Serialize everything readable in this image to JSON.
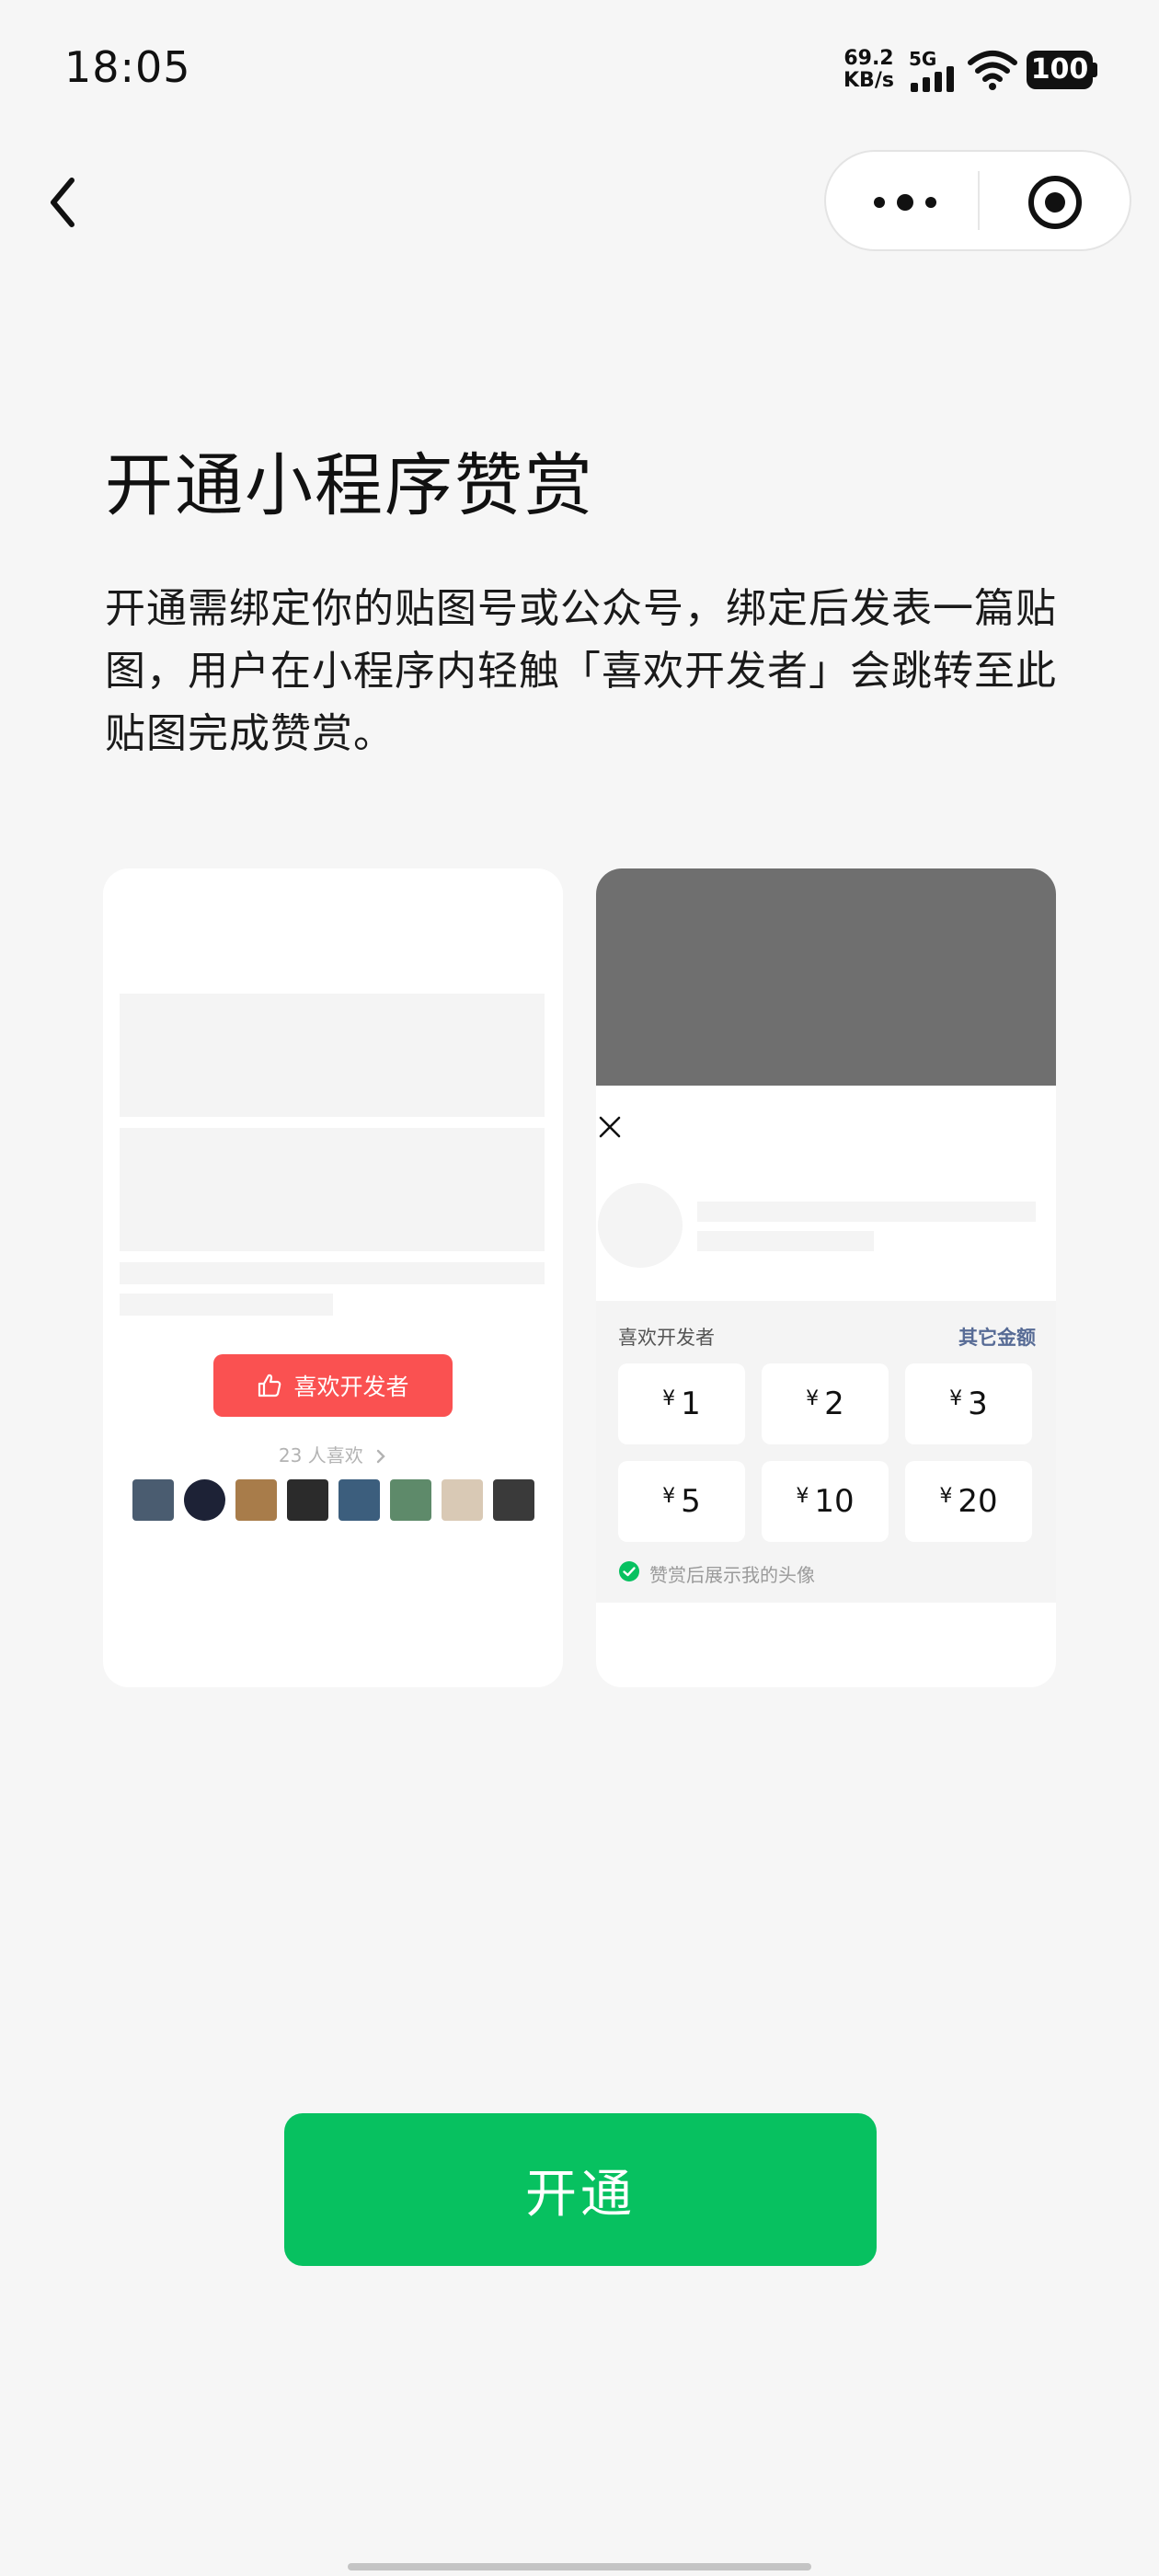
{
  "status_bar": {
    "time": "18:05",
    "net_speed_value": "69.2",
    "net_speed_unit": "KB/s",
    "network_type": "5G",
    "battery": "100"
  },
  "capsule": {
    "more_icon": "ellipsis-icon",
    "close_icon": "target-icon"
  },
  "page": {
    "title": "开通小程序赞赏",
    "description": "开通需绑定你的贴图号或公众号，绑定后发表一篇贴图，用户在小程序内轻触「喜欢开发者」会跳转至此贴图完成赞赏。"
  },
  "preview_left": {
    "like_button_label": "喜欢开发者",
    "likes_count": "23 人喜欢",
    "avatar_colors": [
      "#4a5c70",
      "#1d2236",
      "#a87c4a",
      "#2b2b2b",
      "#3c5e7d",
      "#5e8a6a",
      "#d9c9b5",
      "#3a3a3a"
    ]
  },
  "preview_right": {
    "panel_label": "喜欢开发者",
    "other_amount_label": "其它金额",
    "currency_symbol": "¥",
    "amounts": [
      "1",
      "2",
      "3",
      "5",
      "10",
      "20"
    ],
    "show_avatar_label": "赞赏后展示我的头像"
  },
  "primary_button": {
    "label": "开通"
  },
  "colors": {
    "accent_green": "#07c160",
    "like_red": "#fa5151",
    "link_blue": "#576b95"
  }
}
